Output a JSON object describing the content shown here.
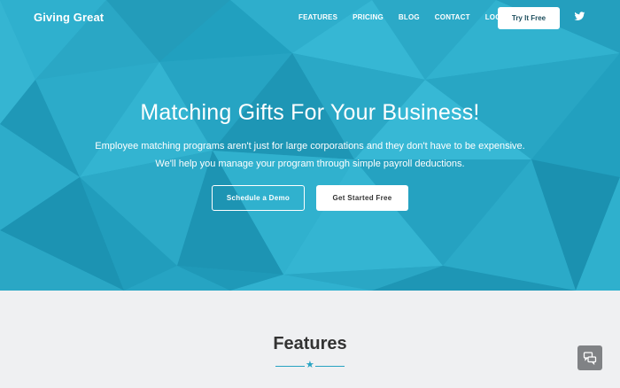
{
  "brand": {
    "name": "Giving Great"
  },
  "nav": {
    "items": [
      {
        "label": "FEATURES"
      },
      {
        "label": "PRICING"
      },
      {
        "label": "BLOG"
      },
      {
        "label": "CONTACT"
      },
      {
        "label": "LOGIN"
      }
    ],
    "cta_label": "Try It Free",
    "social_icon": "twitter-icon"
  },
  "hero": {
    "headline": "Matching Gifts For Your Business!",
    "subtext_line1": "Employee matching programs aren't just for large corporations and they don't have to be expensive.",
    "subtext_line2": "We'll help you manage your program through simple payroll deductions.",
    "demo_label": "Schedule a Demo",
    "start_label": "Get Started Free"
  },
  "features": {
    "title": "Features",
    "divider_icon": "star-icon"
  },
  "chat": {
    "icon": "chat-bubbles-icon"
  },
  "colors": {
    "accent": "#27a3c2",
    "hero_dark": "#1a8eab",
    "hero_light": "#3fb6d3",
    "section_bg": "#eff0f2"
  }
}
